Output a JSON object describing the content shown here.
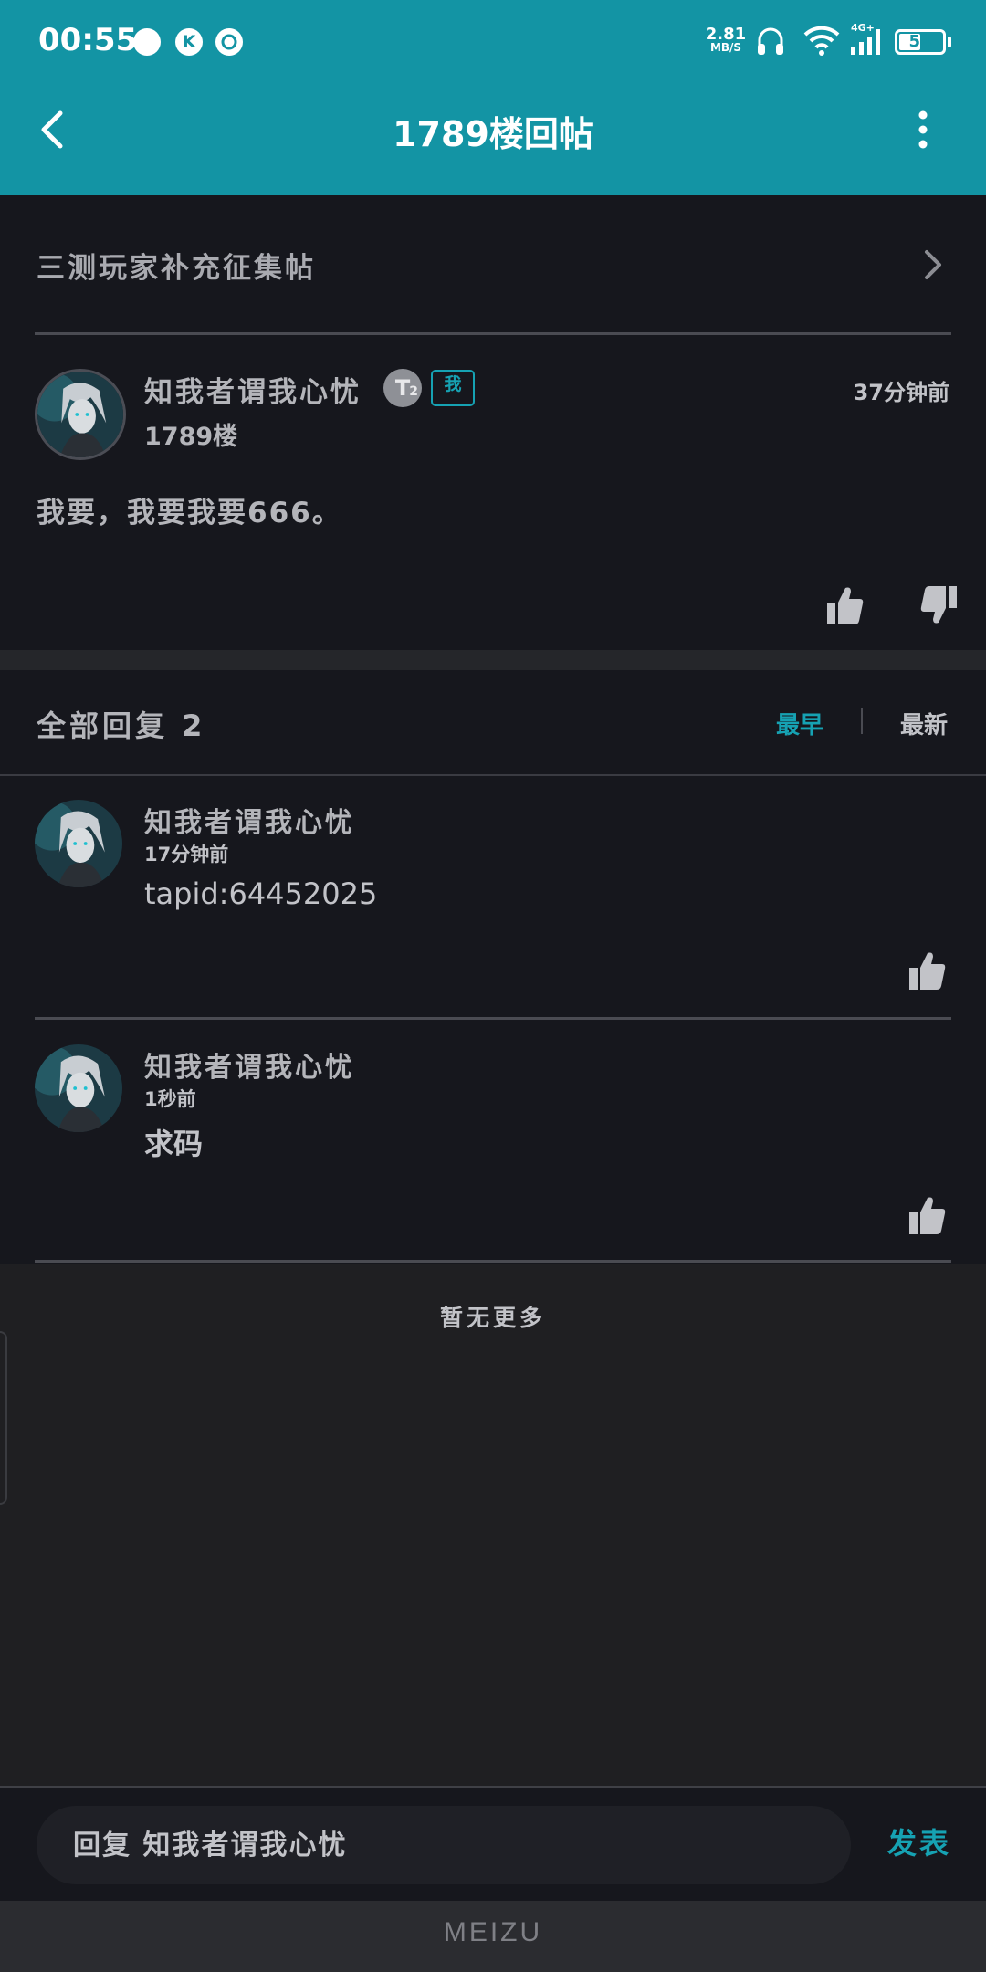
{
  "status_bar": {
    "time": "00:55",
    "notif_k": "K",
    "speed_value": "2.81",
    "speed_unit": "MB/S",
    "network_label": "4G+",
    "battery": "54",
    "battery_fraction": 0.54
  },
  "nav": {
    "title": "1789楼回帖"
  },
  "post": {
    "thread_title": "三测玩家补充征集帖",
    "author": "知我者谓我心忧",
    "level": "T",
    "level_sub": "2",
    "me_tag": "我",
    "time": "37分钟前",
    "floor": "1789楼",
    "content": "我要，我要我要666。"
  },
  "replies": {
    "header": "全部回复 2",
    "sort_earliest": "最早",
    "sort_latest": "最新",
    "items": [
      {
        "author": "知我者谓我心忧",
        "time": "17分钟前",
        "text": "tapid:64452025"
      },
      {
        "author": "知我者谓我心忧",
        "time": "1秒前",
        "text": "求码"
      }
    ],
    "no_more": "暂无更多"
  },
  "composer": {
    "placeholder": "回复 知我者谓我心忧",
    "publish": "发表"
  },
  "brand": "MEIZU",
  "colors": {
    "accent": "#16a2b3",
    "header_bg": "#1394a4",
    "card_bg": "#16171d",
    "page_bg": "#1f1f22"
  },
  "icons": {
    "back": "chevron-left-icon",
    "more": "more-vertical-icon",
    "thread_arrow": "chevron-right-icon",
    "like": "thumbs-up-icon",
    "dislike": "thumbs-down-icon"
  }
}
